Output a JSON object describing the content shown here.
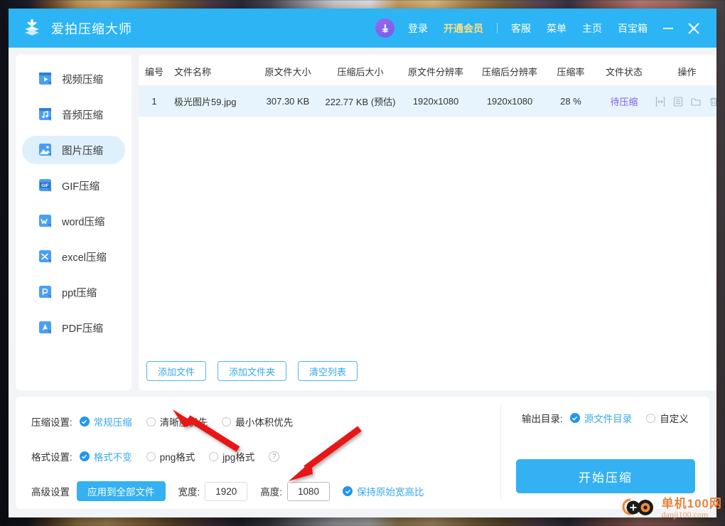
{
  "titlebar": {
    "app_title": "爱拍压缩大师",
    "logo_icon": "stacked-download-arrow-icon",
    "avatar_icon": "user-avatar-download-icon",
    "login_label": "登录",
    "vip_label": "开通会员",
    "vip_color": "#ffe082",
    "links": [
      {
        "label": "客服",
        "name": "customer-service"
      },
      {
        "label": "菜单",
        "name": "menu"
      },
      {
        "label": "主页",
        "name": "homepage"
      },
      {
        "label": "百宝箱",
        "name": "toolbox"
      }
    ],
    "minimize_icon": "minimize-icon",
    "close_icon": "close-icon",
    "bg_color": "#2cb4f5"
  },
  "sidebar": {
    "items": [
      {
        "label": "视频压缩",
        "icon": "video-file-icon",
        "active": false
      },
      {
        "label": "音频压缩",
        "icon": "audio-file-icon",
        "active": false
      },
      {
        "label": "图片压缩",
        "icon": "image-file-icon",
        "active": true
      },
      {
        "label": "GIF压缩",
        "icon": "gif-file-icon",
        "active": false
      },
      {
        "label": "word压缩",
        "icon": "word-file-icon",
        "active": false
      },
      {
        "label": "excel压缩",
        "icon": "excel-file-icon",
        "active": false
      },
      {
        "label": "ppt压缩",
        "icon": "ppt-file-icon",
        "active": false
      },
      {
        "label": "PDF压缩",
        "icon": "pdf-file-icon",
        "active": false
      }
    ],
    "active_bg": "#dff0fd"
  },
  "file_table": {
    "headers": [
      "编号",
      "文件名称",
      "原文件大小",
      "压缩后大小",
      "原文件分辨率",
      "压缩后分辨率",
      "压缩率",
      "文件状态",
      "操作"
    ],
    "rows": [
      {
        "index": "1",
        "filename": "极光图片59.jpg",
        "original_size": "307.30 KB",
        "compressed_size": "222.77 KB (预估)",
        "original_resolution": "1920x1080",
        "compressed_resolution": "1920x1080",
        "ratio": "28 %",
        "status": "待压缩",
        "status_color": "#7d5fe8",
        "row_bg": "#e8f4fd",
        "operations": [
          "compare-icon",
          "detail-list-icon",
          "open-folder-icon",
          "delete-icon"
        ]
      }
    ]
  },
  "file_actions": {
    "add_file": "添加文件",
    "add_folder": "添加文件夹",
    "clear_list": "清空列表"
  },
  "settings": {
    "compression": {
      "label": "压缩设置:",
      "options": [
        {
          "label": "常规压缩",
          "selected": true
        },
        {
          "label": "清晰度优先",
          "selected": false
        },
        {
          "label": "最小体积优先",
          "selected": false
        }
      ]
    },
    "format": {
      "label": "格式设置:",
      "options": [
        {
          "label": "格式不变",
          "selected": true
        },
        {
          "label": "png格式",
          "selected": false
        },
        {
          "label": "jpg格式",
          "selected": false
        }
      ],
      "help_icon": "question-mark-icon"
    },
    "advanced": {
      "label": "高级设置",
      "apply_all": "应用到全部文件",
      "width_label": "宽度:",
      "width_value": "1920",
      "height_label": "高度:",
      "height_value": "1080",
      "keep_ratio_label": "保持原始宽高比",
      "keep_ratio_selected": true
    },
    "output": {
      "label": "输出目录:",
      "options": [
        {
          "label": "源文件目录",
          "selected": true
        },
        {
          "label": "自定义",
          "selected": false
        }
      ]
    },
    "start_button": "开始压缩",
    "accent_color": "#33b1f2",
    "selected_text_color": "#39a9ef"
  },
  "annotations": {
    "arrows": [
      {
        "name": "arrow-to-clarity-priority",
        "color": "#e81919"
      },
      {
        "name": "arrow-to-height-field",
        "color": "#e81919"
      }
    ]
  },
  "watermark": {
    "line1": "单机100网",
    "line2": "danji100.com",
    "icon": "camera-logo-icon",
    "color": "#e8833a"
  }
}
